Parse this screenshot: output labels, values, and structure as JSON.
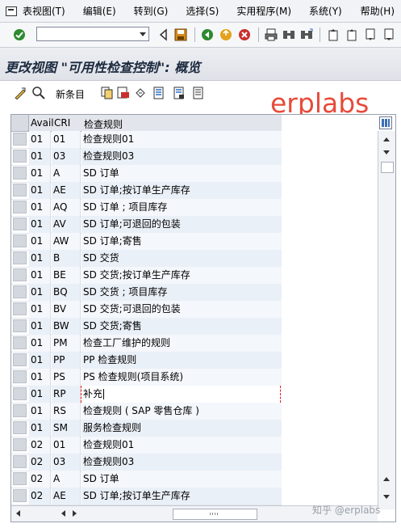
{
  "menu": {
    "items": [
      "表视图(T)",
      "编辑(E)",
      "转到(G)",
      "选择(S)",
      "实用程序(M)",
      "系统(Y)",
      "帮助(H)"
    ]
  },
  "toolbar": {
    "command_field_value": "",
    "icons": [
      "enter-check-icon",
      "back-triangle-icon",
      "save-icon",
      "green-back-icon",
      "exit-icon",
      "cancel-icon",
      "print-icon",
      "find-icon",
      "find-next-icon",
      "first-page-icon",
      "prev-page-icon",
      "next-page-icon",
      "last-page-icon"
    ]
  },
  "title": "更改视图 \"可用性检查控制\": 概览",
  "app_toolbar": {
    "new_entries_label": "新条目",
    "icons": [
      "display-change-icon",
      "details-icon",
      "copy-as-icon",
      "delete-icon",
      "undo-icon",
      "select-all-icon",
      "select-block-icon",
      "deselect-all-icon"
    ]
  },
  "watermark": "erplabs",
  "footer_watermark": "知乎 @erplabs",
  "table": {
    "columns": [
      "Avail",
      "CRI",
      "检查规则"
    ],
    "rows": [
      {
        "avail": "01",
        "cri": "01",
        "rule": "检查规则01"
      },
      {
        "avail": "01",
        "cri": "03",
        "rule": "检查规则03"
      },
      {
        "avail": "01",
        "cri": "A",
        "rule": "SD 订单"
      },
      {
        "avail": "01",
        "cri": "AE",
        "rule": "SD 订单;按订单生产库存"
      },
      {
        "avail": "01",
        "cri": "AQ",
        "rule": "SD 订单 ; 项目库存"
      },
      {
        "avail": "01",
        "cri": "AV",
        "rule": "SD 订单;可退回的包装"
      },
      {
        "avail": "01",
        "cri": "AW",
        "rule": "SD 订单;寄售"
      },
      {
        "avail": "01",
        "cri": "B",
        "rule": "SD 交货"
      },
      {
        "avail": "01",
        "cri": "BE",
        "rule": "SD 交货;按订单生产库存"
      },
      {
        "avail": "01",
        "cri": "BQ",
        "rule": "SD 交货 ; 项目库存"
      },
      {
        "avail": "01",
        "cri": "BV",
        "rule": "SD 交货;可退回的包装"
      },
      {
        "avail": "01",
        "cri": "BW",
        "rule": "SD 交货;寄售"
      },
      {
        "avail": "01",
        "cri": "PM",
        "rule": "检查工厂维护的规则"
      },
      {
        "avail": "01",
        "cri": "PP",
        "rule": "PP 检查规则"
      },
      {
        "avail": "01",
        "cri": "PS",
        "rule": "PS 检查规则(项目系统)"
      },
      {
        "avail": "01",
        "cri": "RP",
        "rule": "补充"
      },
      {
        "avail": "01",
        "cri": "RS",
        "rule": "检查规则 ( SAP 零售仓库 )"
      },
      {
        "avail": "01",
        "cri": "SM",
        "rule": "服务检查规则"
      },
      {
        "avail": "02",
        "cri": "01",
        "rule": "检查规则01"
      },
      {
        "avail": "02",
        "cri": "03",
        "rule": "检查规则03"
      },
      {
        "avail": "02",
        "cri": "A",
        "rule": "SD 订单"
      },
      {
        "avail": "02",
        "cri": "AE",
        "rule": "SD 订单;按订单生产库存"
      }
    ]
  }
}
